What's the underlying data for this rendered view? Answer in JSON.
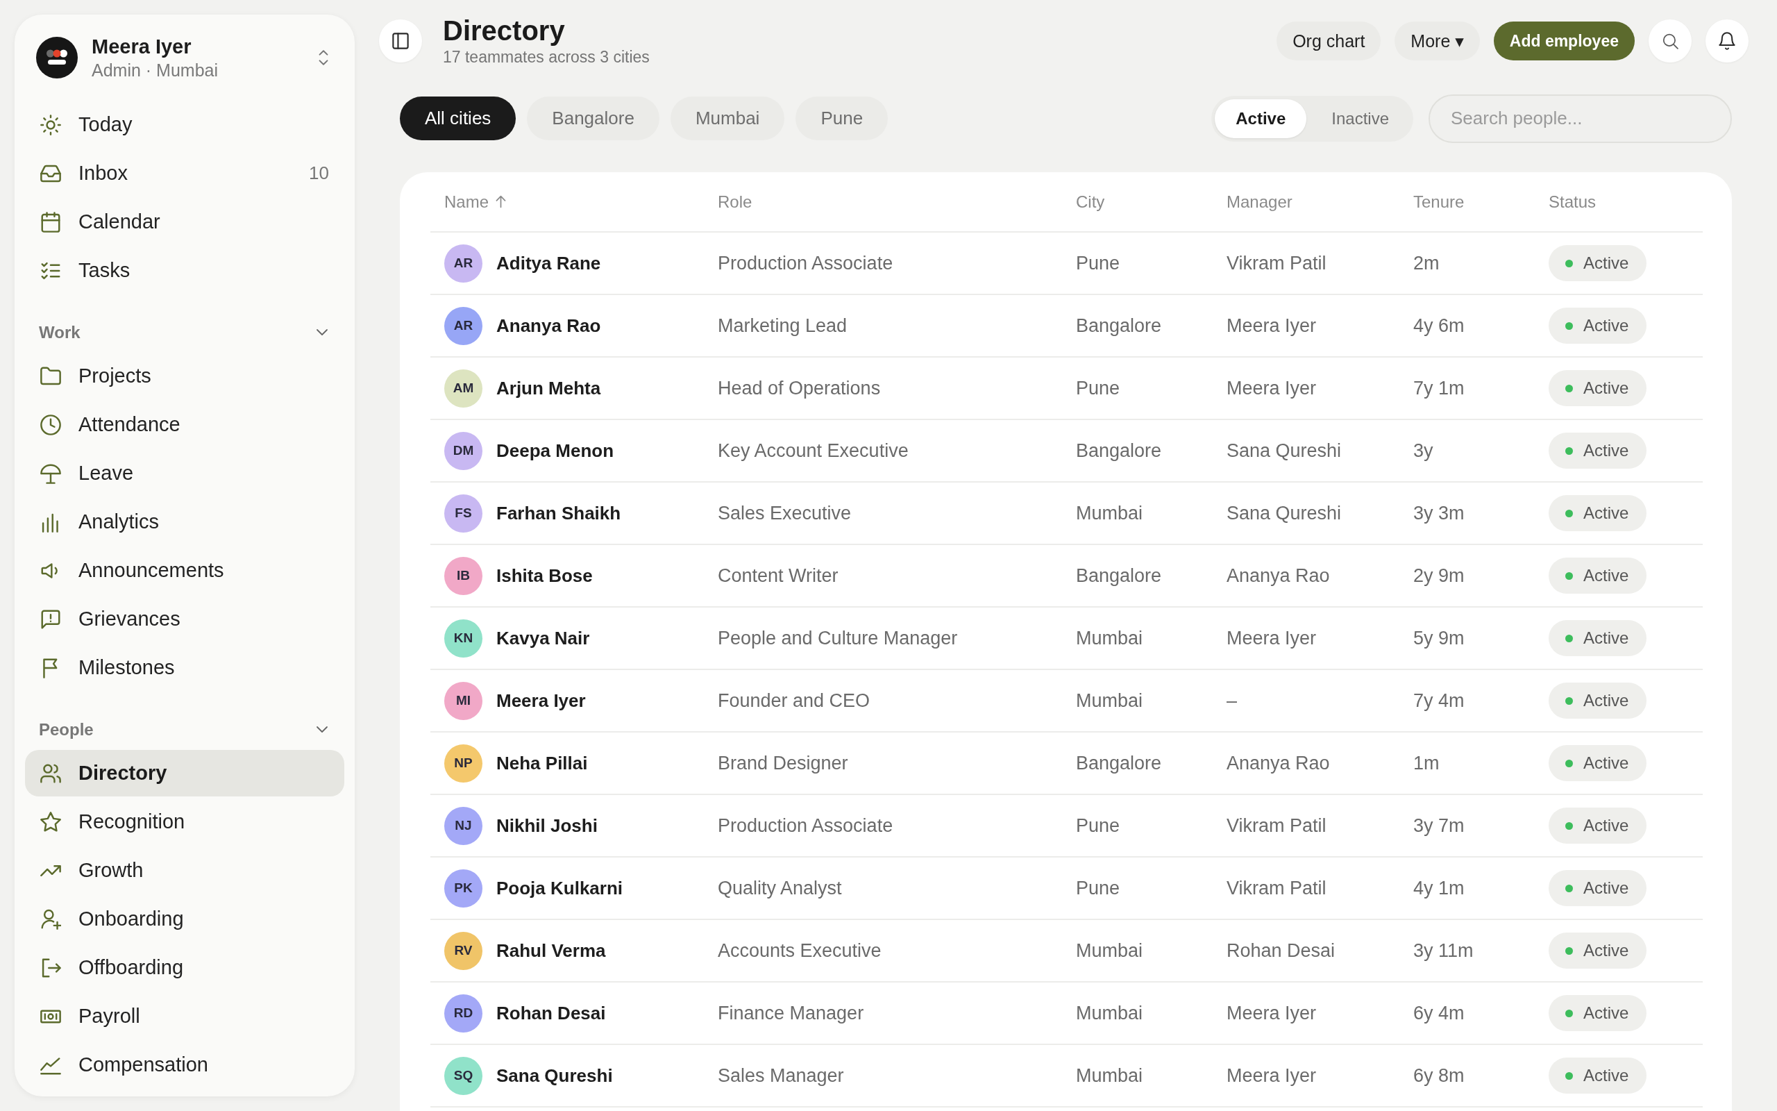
{
  "sidebar": {
    "profile": {
      "name": "Meera Iyer",
      "subtitle": "Admin · Mumbai"
    },
    "items": [
      {
        "label": "Today",
        "selected": false
      },
      {
        "label": "Inbox",
        "count": "10",
        "selected": false
      },
      {
        "label": "Calendar",
        "selected": false
      },
      {
        "label": "Tasks",
        "selected": false
      }
    ],
    "sections": [
      {
        "title": "Work",
        "expanded": true,
        "items": [
          {
            "label": "Projects",
            "selected": false
          },
          {
            "label": "Attendance",
            "selected": false
          },
          {
            "label": "Leave",
            "selected": false
          },
          {
            "label": "Analytics",
            "selected": false
          },
          {
            "label": "Announcements",
            "selected": false
          },
          {
            "label": "Grievances",
            "selected": false
          },
          {
            "label": "Milestones",
            "selected": false
          }
        ]
      },
      {
        "title": "People",
        "expanded": true,
        "items": [
          {
            "label": "Directory",
            "selected": true
          },
          {
            "label": "Recognition",
            "selected": false
          },
          {
            "label": "Growth",
            "selected": false
          },
          {
            "label": "Onboarding",
            "selected": false
          },
          {
            "label": "Offboarding",
            "selected": false
          },
          {
            "label": "Payroll",
            "selected": false
          },
          {
            "label": "Compensation",
            "selected": false
          }
        ]
      }
    ]
  },
  "header": {
    "title": "Directory",
    "subtitle": "17 teammates across 3 cities",
    "actions": [
      {
        "label": "Org chart",
        "kind": "secondary"
      },
      {
        "label": "More ▾",
        "kind": "secondary"
      },
      {
        "label": "Add employee",
        "kind": "primary"
      }
    ]
  },
  "city_filters": [
    {
      "label": "All cities",
      "selected": true
    },
    {
      "label": "Bangalore",
      "selected": false
    },
    {
      "label": "Mumbai",
      "selected": false
    },
    {
      "label": "Pune",
      "selected": false
    }
  ],
  "status_filter": [
    {
      "label": "Active",
      "selected": true
    },
    {
      "label": "Inactive",
      "selected": false
    }
  ],
  "search": {
    "placeholder": "Search people..."
  },
  "table": {
    "columns": [
      {
        "label": "Name",
        "sorted": true
      },
      {
        "label": "Role",
        "sorted": false
      },
      {
        "label": "City",
        "sorted": false
      },
      {
        "label": "Manager",
        "sorted": false
      },
      {
        "label": "Tenure",
        "sorted": false
      },
      {
        "label": "Status",
        "sorted": false
      }
    ],
    "rows": [
      {
        "initials": "AR",
        "color": "#c8b8f2",
        "name": "Aditya Rane",
        "role": "Production Associate",
        "city": "Pune",
        "manager": "Vikram Patil",
        "tenure": "2m",
        "status": {
          "label": "Active",
          "kind": "active"
        }
      },
      {
        "initials": "AR",
        "color": "#97a6f6",
        "name": "Ananya Rao",
        "role": "Marketing Lead",
        "city": "Bangalore",
        "manager": "Meera Iyer",
        "tenure": "4y 6m",
        "status": {
          "label": "Active",
          "kind": "active"
        }
      },
      {
        "initials": "AM",
        "color": "#dde4c0",
        "name": "Arjun Mehta",
        "role": "Head of Operations",
        "city": "Pune",
        "manager": "Meera Iyer",
        "tenure": "7y 1m",
        "status": {
          "label": "Active",
          "kind": "active"
        }
      },
      {
        "initials": "DM",
        "color": "#c8b8f2",
        "name": "Deepa Menon",
        "role": "Key Account Executive",
        "city": "Bangalore",
        "manager": "Sana Qureshi",
        "tenure": "3y",
        "status": {
          "label": "Active",
          "kind": "active"
        }
      },
      {
        "initials": "FS",
        "color": "#c8b8f2",
        "name": "Farhan Shaikh",
        "role": "Sales Executive",
        "city": "Mumbai",
        "manager": "Sana Qureshi",
        "tenure": "3y 3m",
        "status": {
          "label": "Active",
          "kind": "active"
        }
      },
      {
        "initials": "IB",
        "color": "#f1a8c7",
        "name": "Ishita Bose",
        "role": "Content Writer",
        "city": "Bangalore",
        "manager": "Ananya Rao",
        "tenure": "2y 9m",
        "status": {
          "label": "Active",
          "kind": "active"
        }
      },
      {
        "initials": "KN",
        "color": "#90e2c9",
        "name": "Kavya Nair",
        "role": "People and Culture Manager",
        "city": "Mumbai",
        "manager": "Meera Iyer",
        "tenure": "5y 9m",
        "status": {
          "label": "Active",
          "kind": "active"
        }
      },
      {
        "initials": "MI",
        "color": "#f1a8c7",
        "name": "Meera Iyer",
        "role": "Founder and CEO",
        "city": "Mumbai",
        "manager": "–",
        "tenure": "7y 4m",
        "status": {
          "label": "Active",
          "kind": "active"
        }
      },
      {
        "initials": "NP",
        "color": "#f4c86c",
        "name": "Neha Pillai",
        "role": "Brand Designer",
        "city": "Bangalore",
        "manager": "Ananya Rao",
        "tenure": "1m",
        "status": {
          "label": "Active",
          "kind": "active"
        }
      },
      {
        "initials": "NJ",
        "color": "#a3a8f7",
        "name": "Nikhil Joshi",
        "role": "Production Associate",
        "city": "Pune",
        "manager": "Vikram Patil",
        "tenure": "3y 7m",
        "status": {
          "label": "Active",
          "kind": "active"
        }
      },
      {
        "initials": "PK",
        "color": "#a3a8f7",
        "name": "Pooja Kulkarni",
        "role": "Quality Analyst",
        "city": "Pune",
        "manager": "Vikram Patil",
        "tenure": "4y 1m",
        "status": {
          "label": "Active",
          "kind": "active"
        }
      },
      {
        "initials": "RV",
        "color": "#f0c468",
        "name": "Rahul Verma",
        "role": "Accounts Executive",
        "city": "Mumbai",
        "manager": "Rohan Desai",
        "tenure": "3y 11m",
        "status": {
          "label": "Active",
          "kind": "active"
        }
      },
      {
        "initials": "RD",
        "color": "#a3a8f7",
        "name": "Rohan Desai",
        "role": "Finance Manager",
        "city": "Mumbai",
        "manager": "Meera Iyer",
        "tenure": "6y 4m",
        "status": {
          "label": "Active",
          "kind": "active"
        }
      },
      {
        "initials": "SQ",
        "color": "#90e2c9",
        "name": "Sana Qureshi",
        "role": "Sales Manager",
        "city": "Mumbai",
        "manager": "Meera Iyer",
        "tenure": "6y 8m",
        "status": {
          "label": "Active",
          "kind": "active"
        }
      }
    ]
  }
}
